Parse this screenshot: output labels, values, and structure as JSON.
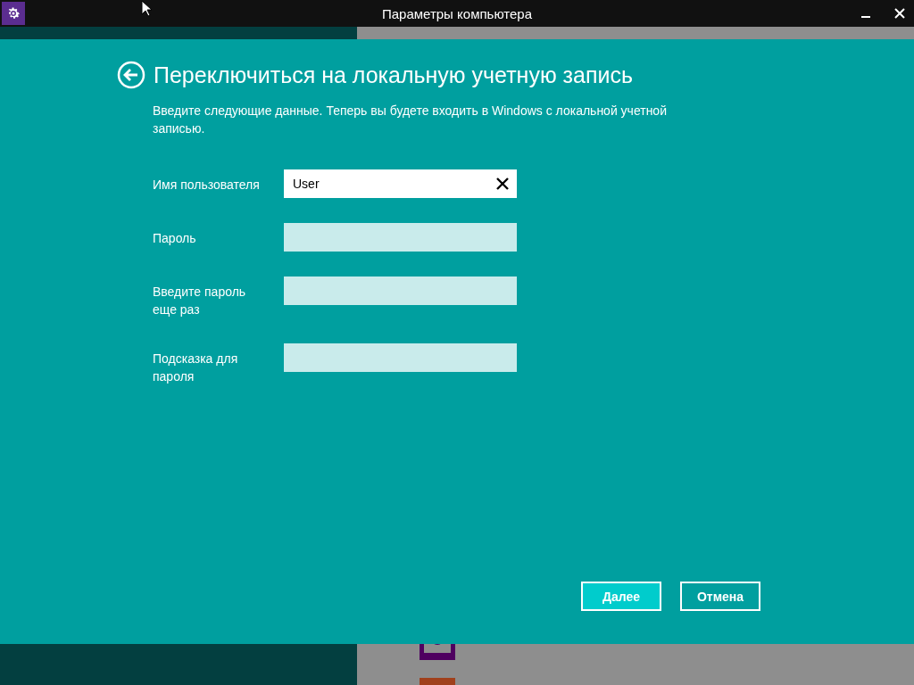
{
  "window": {
    "title": "Параметры компьютера"
  },
  "dialog": {
    "title": "Переключиться на локальную учетную запись",
    "description": "Введите следующие данные. Теперь вы будете входить в Windows с локальной учетной записью.",
    "fields": [
      {
        "label": "Имя пользователя",
        "value": "User",
        "focused": true
      },
      {
        "label": "Пароль",
        "focused": false
      },
      {
        "label": "Введите пароль еще раз",
        "focused": false
      },
      {
        "label": "Подсказка для пароля",
        "focused": false
      }
    ],
    "buttons": [
      {
        "label": "Далее",
        "kind": "primary"
      },
      {
        "label": "Отмена",
        "kind": "secondary"
      }
    ]
  }
}
